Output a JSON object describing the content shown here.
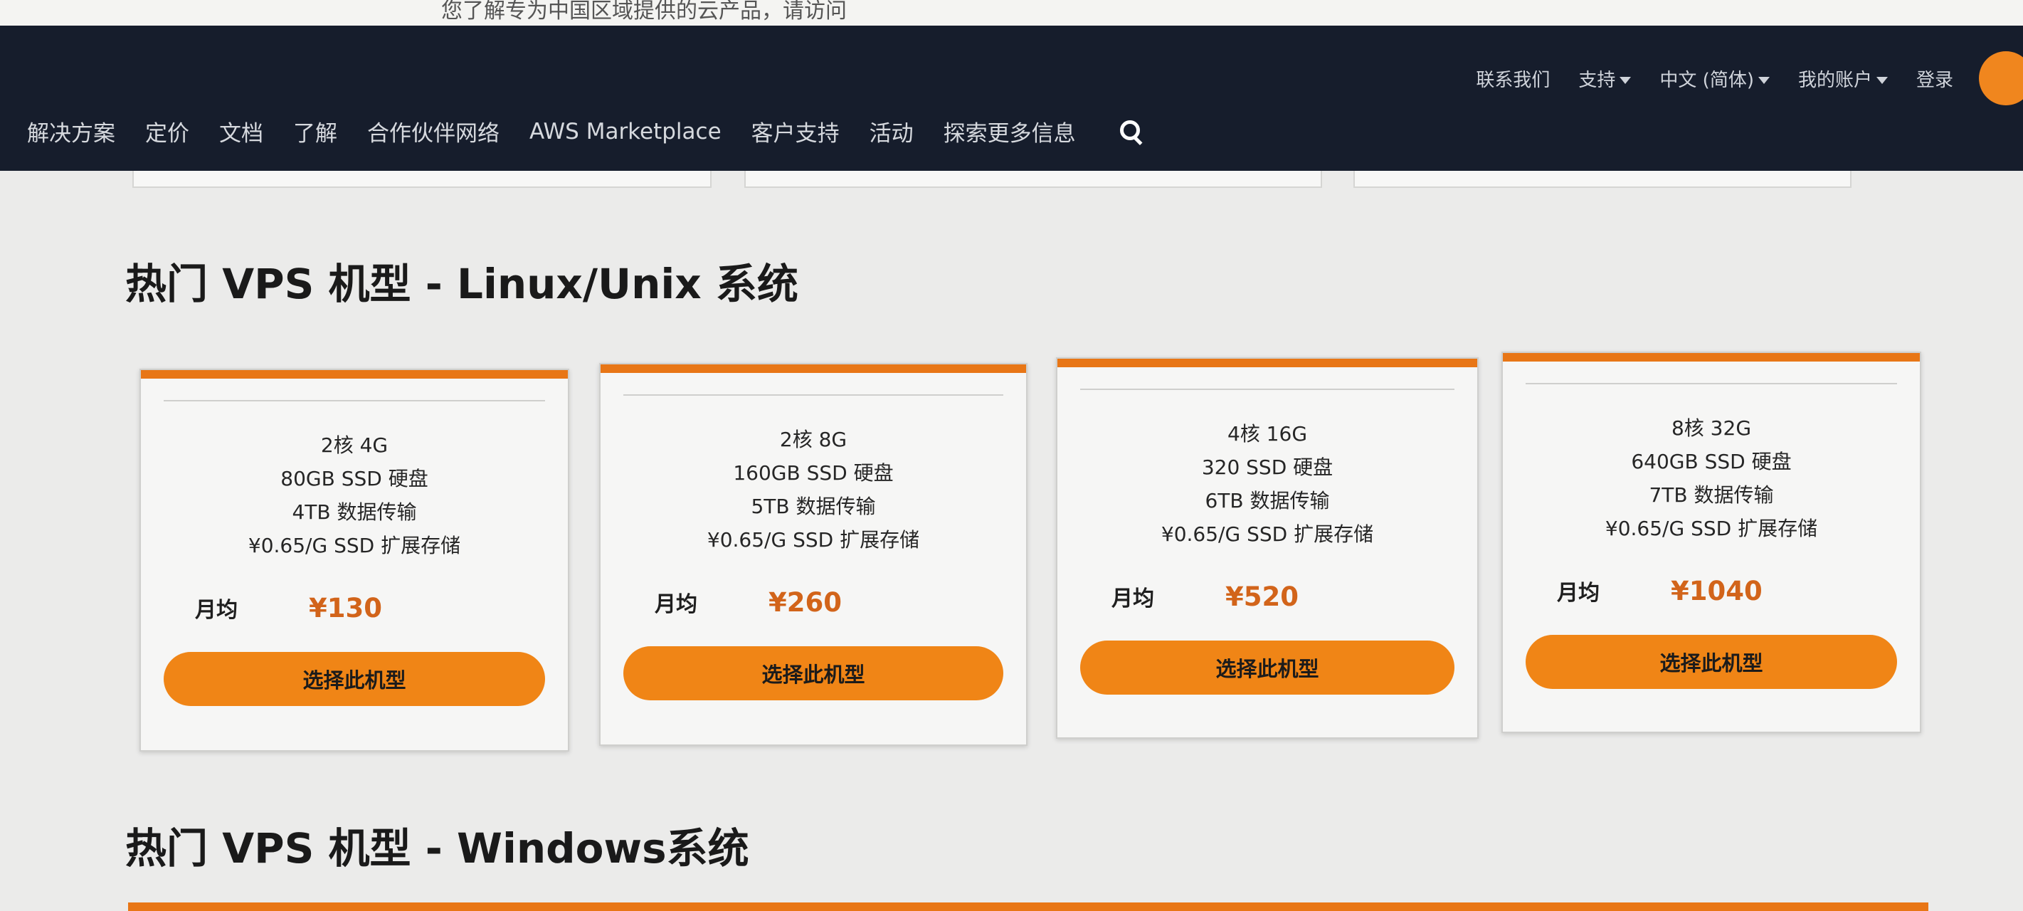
{
  "top_strip": {
    "text": "您了解专为中国区域提供的云产品，请访问"
  },
  "header": {
    "utility": [
      {
        "label": "联系我们",
        "has_dropdown": false
      },
      {
        "label": "支持",
        "has_dropdown": true
      },
      {
        "label": "中文 (简体)",
        "has_dropdown": true
      },
      {
        "label": "我的账户",
        "has_dropdown": true
      },
      {
        "label": "登录",
        "has_dropdown": false
      }
    ],
    "nav": [
      "解决方案",
      "定价",
      "文档",
      "了解",
      "合作伙伴网络",
      "AWS Marketplace",
      "客户支持",
      "活动",
      "探索更多信息"
    ],
    "search_icon": "search-icon"
  },
  "sections": {
    "linux_title": "热门 VPS 机型 - Linux/Unix 系统",
    "windows_title": "热门 VPS 机型 - Windows系统"
  },
  "cards": [
    {
      "specs": [
        "2核 4G",
        "80GB SSD 硬盘",
        "4TB 数据传输",
        "¥0.65/G SSD 扩展存储"
      ],
      "price_label": "月均",
      "price": "¥130",
      "button": "选择此机型"
    },
    {
      "specs": [
        "2核 8G",
        "160GB SSD 硬盘",
        "5TB 数据传输",
        "¥0.65/G SSD 扩展存储"
      ],
      "price_label": "月均",
      "price": "¥260",
      "button": "选择此机型"
    },
    {
      "specs": [
        "4核 16G",
        "320 SSD 硬盘",
        "6TB 数据传输",
        "¥0.65/G SSD 扩展存储"
      ],
      "price_label": "月均",
      "price": "¥520",
      "button": "选择此机型"
    },
    {
      "specs": [
        "8核 32G",
        "640GB SSD 硬盘",
        "7TB 数据传输",
        "¥0.65/G SSD 扩展存储"
      ],
      "price_label": "月均",
      "price": "¥1040",
      "button": "选择此机型"
    }
  ],
  "colors": {
    "nav_bg": "#161d2c",
    "accent": "#f08516",
    "price": "#d2641a",
    "page_bg": "#ebebea"
  }
}
